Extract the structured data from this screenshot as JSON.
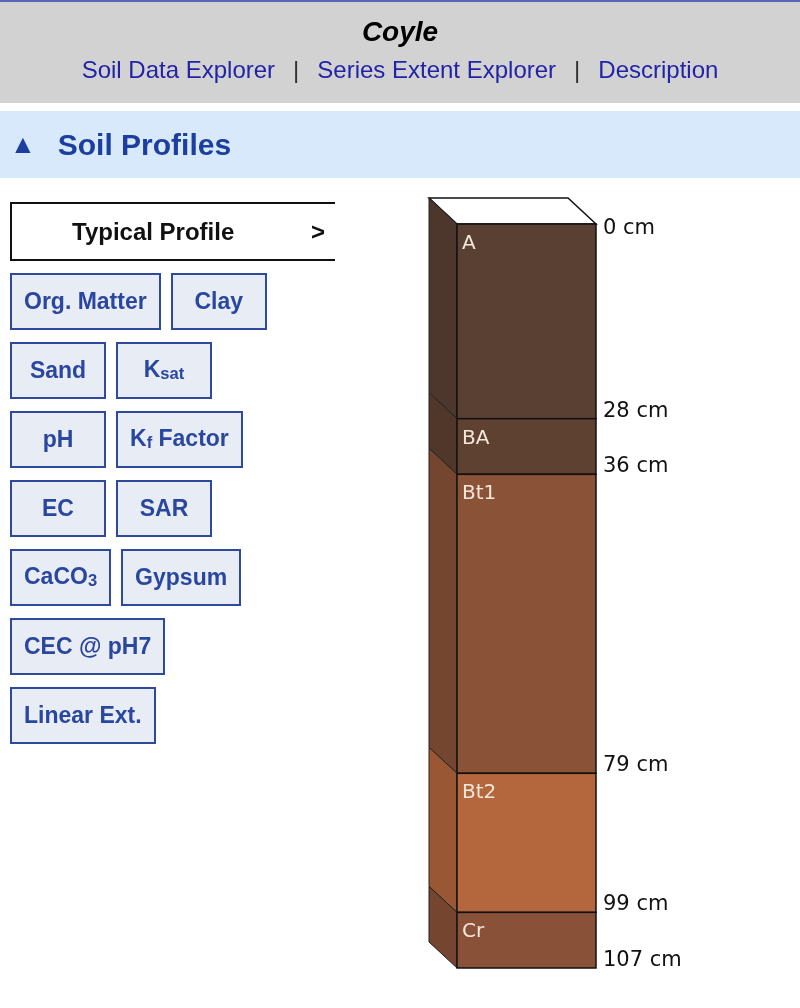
{
  "header": {
    "title": "Coyle",
    "nav": [
      {
        "kind": "link",
        "text": "Soil Data Explorer"
      },
      {
        "kind": "separator",
        "text": "|"
      },
      {
        "kind": "link",
        "text": "Series Extent Explorer"
      },
      {
        "kind": "separator",
        "text": "|"
      },
      {
        "kind": "link",
        "text": "Description"
      }
    ]
  },
  "section": {
    "toggle": "▲",
    "title": "Soil Profiles",
    "expanded": true
  },
  "typical_profile": {
    "label": "Typical Profile",
    "arrow": ">",
    "selected": true
  },
  "property_rows": [
    [
      {
        "label": "Org. Matter",
        "selected": false
      },
      {
        "label": "Clay",
        "selected": false
      }
    ],
    [
      {
        "label": "Sand",
        "selected": false
      },
      {
        "label": "K$_{sat}$",
        "selected": false
      }
    ],
    [
      {
        "label": "pH",
        "selected": false
      },
      {
        "label": "K$_{f}$ Factor",
        "selected": false
      }
    ],
    [
      {
        "label": "EC",
        "selected": false
      },
      {
        "label": "SAR",
        "selected": false
      }
    ],
    [
      {
        "label": "CaCO$_{3}$",
        "selected": false
      },
      {
        "label": "Gypsum",
        "selected": false
      }
    ],
    [
      {
        "label": "CEC @ pH7",
        "selected": false
      }
    ],
    [
      {
        "label": "Linear Ext.",
        "selected": false
      }
    ]
  ],
  "profile": {
    "depth_labels": [
      "0 cm",
      "28 cm",
      "36 cm",
      "79 cm",
      "99 cm",
      "107 cm"
    ],
    "horizons": [
      {
        "name": "A",
        "color": "#5a4033"
      },
      {
        "name": "BA",
        "color": "#5e4131"
      },
      {
        "name": "Bt1",
        "color": "#8a5237"
      },
      {
        "name": "Bt2",
        "color": "#b4663c"
      },
      {
        "name": "Cr",
        "color": "#8a5139"
      }
    ]
  }
}
